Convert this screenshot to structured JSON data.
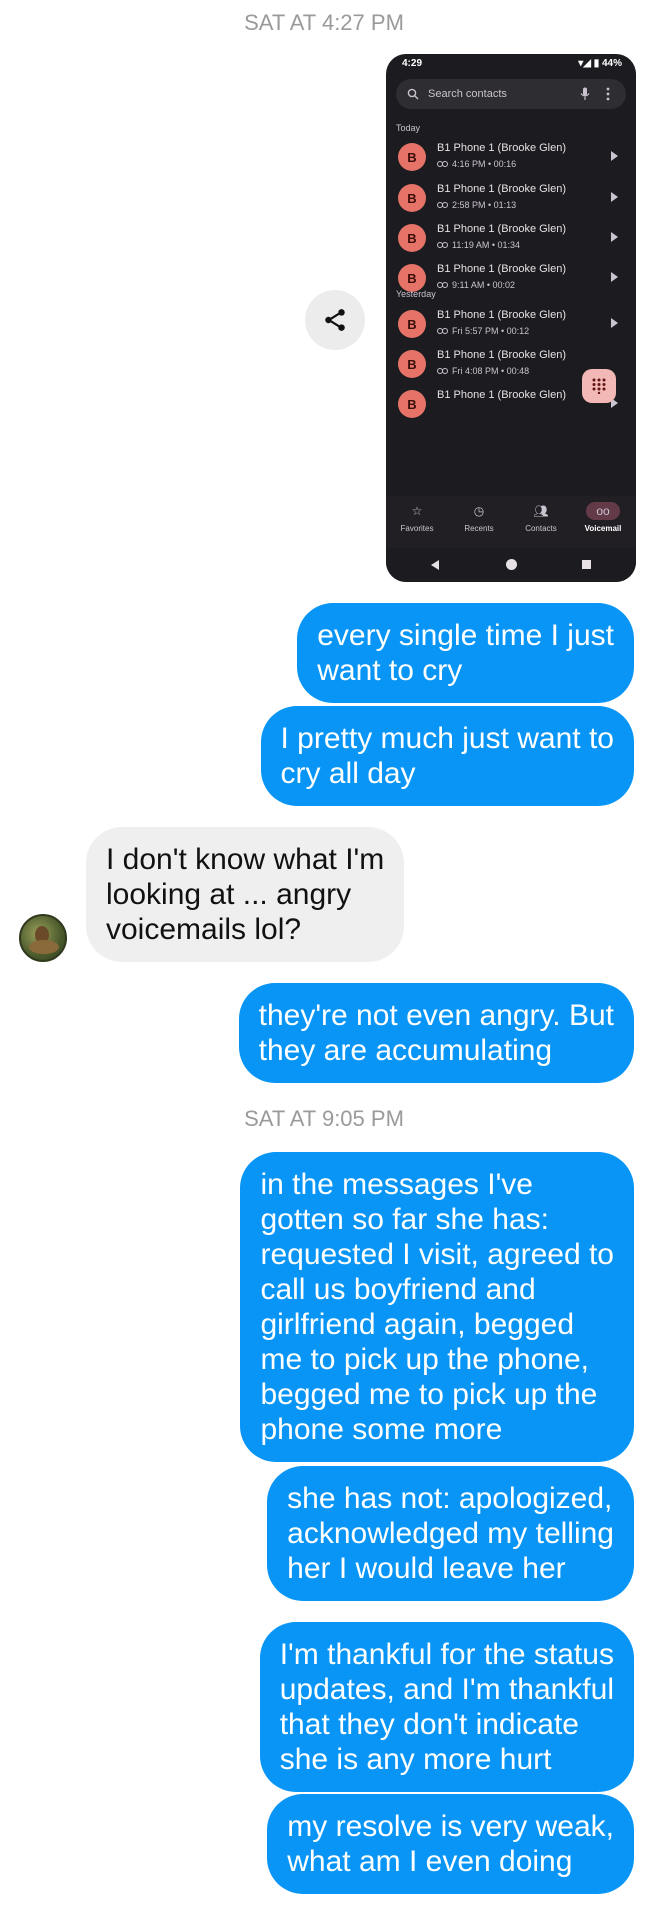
{
  "timestamps": [
    "SAT AT 4:27 PM",
    "SAT AT 9:05 PM"
  ],
  "phone": {
    "status_time": "4:29",
    "battery": "44%",
    "search_placeholder": "Search contacts",
    "sections": [
      "Today",
      "Yesterday"
    ],
    "voicemails": [
      {
        "initial": "B",
        "name": "B1 Phone 1 (Brooke Glen)",
        "meta": "4:16 PM • 00:16"
      },
      {
        "initial": "B",
        "name": "B1 Phone 1 (Brooke Glen)",
        "meta": "2:58 PM • 01:13"
      },
      {
        "initial": "B",
        "name": "B1 Phone 1 (Brooke Glen)",
        "meta": "11:19 AM • 01:34"
      },
      {
        "initial": "B",
        "name": "B1 Phone 1 (Brooke Glen)",
        "meta": "9:11 AM • 00:02"
      },
      {
        "initial": "B",
        "name": "B1 Phone 1 (Brooke Glen)",
        "meta": "Fri 5:57 PM • 00:12"
      },
      {
        "initial": "B",
        "name": "B1 Phone 1 (Brooke Glen)",
        "meta": "Fri 4:08 PM • 00:48"
      },
      {
        "initial": "B",
        "name": "B1 Phone 1 (Brooke Glen)",
        "meta": ""
      }
    ],
    "nav": [
      "Favorites",
      "Recents",
      "Contacts",
      "Voicemail"
    ]
  },
  "messages": [
    {
      "text": "every single time I just\nwant to cry"
    },
    {
      "text": "I pretty much just want to\ncry all day"
    },
    {
      "text": "I don't know what I'm\nlooking at ... angry\nvoicemails lol?"
    },
    {
      "text": "they're not even angry. But\nthey are accumulating"
    },
    {
      "text": "in the messages I've\ngotten so far she has:\nrequested I visit, agreed to\ncall us boyfriend and\ngirlfriend again, begged\nme to pick up the phone,\nbegged me to pick up the\nphone some more"
    },
    {
      "text": "she has not: apologized,\nacknowledged my telling\nher I would leave her"
    },
    {
      "text": "I'm thankful for the status\nupdates, and I'm thankful\nthat they don't indicate\nshe is any more hurt"
    },
    {
      "text": "my resolve is very weak,\nwhat am I even doing"
    }
  ],
  "colors": {
    "outgoing": "#0895f5",
    "incoming": "#efefef",
    "voicemail_avatar": "#e57368"
  }
}
